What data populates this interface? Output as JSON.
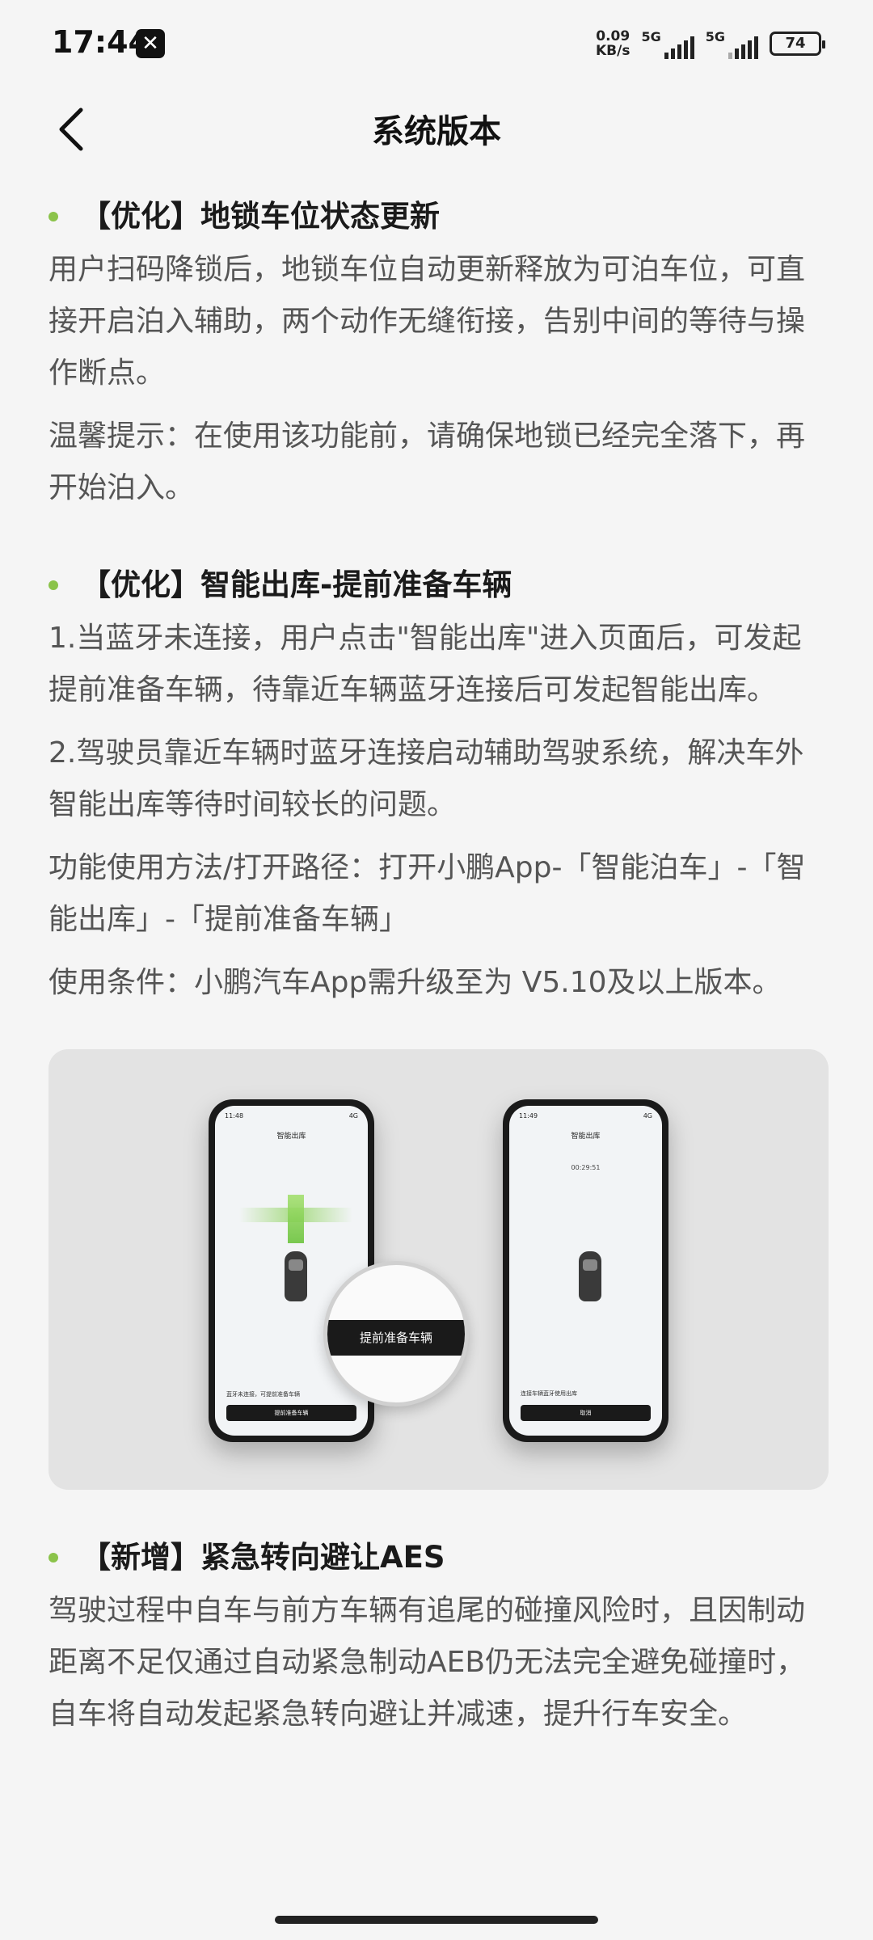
{
  "status_bar": {
    "time": "17:44",
    "app_icon": "close-x-icon",
    "speed_value": "0.09",
    "speed_unit": "KB/s",
    "net1": "5G",
    "net2": "5G",
    "battery": "74"
  },
  "header": {
    "back_icon": "chevron-left-icon",
    "title": "系统版本"
  },
  "sections": [
    {
      "title": "【优化】地锁车位状态更新",
      "paragraphs": [
        "用户扫码降锁后，地锁车位自动更新释放为可泊车位，可直接开启泊入辅助，两个动作无缝衔接，告别中间的等待与操作断点。",
        "温馨提示：在使用该功能前，请确保地锁已经完全落下，再开始泊入。"
      ]
    },
    {
      "title": "【优化】智能出库-提前准备车辆",
      "paragraphs": [
        "1.当蓝牙未连接，用户点击\"智能出库\"进入页面后，可发起提前准备车辆，待靠近车辆蓝牙连接后可发起智能出库。",
        "2.驾驶员靠近车辆时蓝牙连接启动辅助驾驶系统，解决车外智能出库等待时间较长的问题。",
        "功能使用方法/打开路径：打开小鹏App-「智能泊车」-「智能出库」-「提前准备车辆」",
        "使用条件：小鹏汽车App需升级至为 V5.10及以上版本。"
      ]
    },
    {
      "title": "【新增】紧急转向避让AES",
      "paragraphs": [
        "驾驶过程中自车与前方车辆有追尾的碰撞风险时，且因制动距离不足仅通过自动紧急制动AEB仍无法完全避免碰撞时，自车将自动发起紧急转向避让并减速，提升行车安全。"
      ]
    }
  ],
  "illustration": {
    "phone_left": {
      "time": "11:48",
      "signal": "4G",
      "title": "智能出库",
      "note": "蓝牙未连接，可提前准备车辆",
      "button": "提前准备车辆"
    },
    "magnifier_button": "提前准备车辆",
    "phone_right": {
      "time": "11:49",
      "signal": "4G",
      "title": "智能出库",
      "timer": "00:29:51",
      "status": "连接车辆蓝牙使用出库",
      "button": "取消"
    }
  },
  "colors": {
    "bullet": "#8bc34a",
    "background": "#f5f5f5"
  }
}
